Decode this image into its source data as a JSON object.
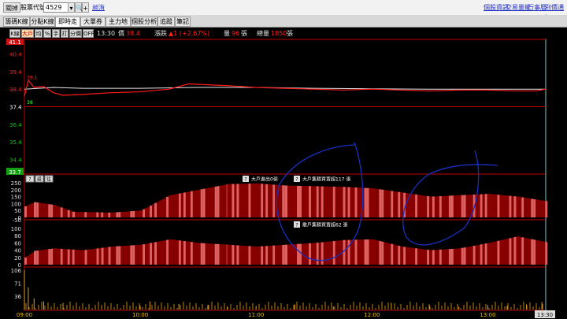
{
  "window": {
    "close_button": "關掉",
    "stock_code_label": "股票代號:",
    "stock_code_value": "4529",
    "search_icon_glyph": "🔍",
    "add_button": "+",
    "stock_name": "昶洧",
    "links": [
      "個股資訊",
      "交易量能",
      "行事曆",
      "到價通知"
    ]
  },
  "tabs": [
    "籌碼K線",
    "分點K線",
    "即時走勢",
    "大單券商",
    "主力地圖",
    "個股分析",
    "追蹤",
    "筆記"
  ],
  "active_tab": "即時走勢",
  "toolbar": {
    "buttons": [
      "K線",
      "大戶",
      "均",
      "%",
      "手",
      "打",
      "分價",
      "OFF"
    ],
    "selected": "大戶",
    "time": "13:30",
    "price_label": "價",
    "price_value": "38.4",
    "change_label": "漲跌",
    "change_value": "▲1 (+2.67%)",
    "volume_label": "量",
    "volume_value": "96",
    "volume_unit": "張",
    "total_label": "總量",
    "total_value": "1850",
    "total_unit": "張"
  },
  "colors": {
    "price_line": "#ff1a1a",
    "avg_line": "#e8e8e8",
    "big_buy_fill": "#e06060",
    "dark_fill": "#8a0000",
    "annotation_ink": "#1830c0",
    "up_color": "#ff2020",
    "down_color": "#00d000",
    "panel_border": "#c00000"
  },
  "chart_data": {
    "type": "line",
    "time_axis": [
      "09:00",
      "10:00",
      "11:00",
      "12:00",
      "13:00"
    ],
    "current_time_label": "13:30",
    "price_panel": {
      "y_ticks_up": [
        "41.1",
        "40.4",
        "39.4",
        "38.4"
      ],
      "y_ticks_down": [
        "37.4",
        "36.4",
        "35.4",
        "34.4",
        "33.7"
      ],
      "open_high_label": "39.1",
      "open_low_label": "38",
      "limit_up": 41.1,
      "limit_down": 33.7,
      "reference": 37.4,
      "price_series": [
        [
          "09:00",
          38.0
        ],
        [
          "09:02",
          38.9
        ],
        [
          "09:05",
          38.5
        ],
        [
          "09:10",
          38.55
        ],
        [
          "09:15",
          38.2
        ],
        [
          "09:20",
          38.05
        ],
        [
          "09:30",
          38.1
        ],
        [
          "09:45",
          38.2
        ],
        [
          "10:00",
          38.25
        ],
        [
          "10:15",
          38.4
        ],
        [
          "10:25",
          38.7
        ],
        [
          "10:35",
          38.65
        ],
        [
          "10:45",
          38.6
        ],
        [
          "11:00",
          38.5
        ],
        [
          "11:15",
          38.45
        ],
        [
          "11:30",
          38.4
        ],
        [
          "11:45",
          38.35
        ],
        [
          "12:00",
          38.4
        ],
        [
          "12:15",
          38.35
        ],
        [
          "12:30",
          38.3
        ],
        [
          "12:45",
          38.35
        ],
        [
          "13:00",
          38.35
        ],
        [
          "13:15",
          38.3
        ],
        [
          "13:25",
          38.3
        ],
        [
          "13:30",
          38.4
        ]
      ],
      "avg_series": [
        [
          "09:00",
          38.4
        ],
        [
          "09:15",
          38.5
        ],
        [
          "09:30",
          38.45
        ],
        [
          "10:00",
          38.45
        ],
        [
          "10:30",
          38.5
        ],
        [
          "11:00",
          38.5
        ],
        [
          "11:30",
          38.45
        ],
        [
          "12:00",
          38.42
        ],
        [
          "12:30",
          38.4
        ],
        [
          "13:00",
          38.4
        ],
        [
          "13:30",
          38.4
        ]
      ]
    },
    "big_player_panel": {
      "header_buttons": [
        "?",
        "設",
        "往"
      ],
      "label_outflow": "大戶進出0張",
      "label_hold": "大戶集積買賣超117 張",
      "y_ticks": [
        "250",
        "200",
        "150",
        "100",
        "50",
        "0"
      ],
      "series": [
        [
          "09:00",
          80
        ],
        [
          "09:05",
          110
        ],
        [
          "09:15",
          90
        ],
        [
          "09:25",
          40
        ],
        [
          "09:45",
          35
        ],
        [
          "10:00",
          50
        ],
        [
          "10:15",
          160
        ],
        [
          "10:30",
          200
        ],
        [
          "10:45",
          240
        ],
        [
          "11:00",
          245
        ],
        [
          "11:15",
          230
        ],
        [
          "11:30",
          225
        ],
        [
          "11:45",
          220
        ],
        [
          "12:00",
          210
        ],
        [
          "12:15",
          180
        ],
        [
          "12:30",
          150
        ],
        [
          "12:45",
          160
        ],
        [
          "13:00",
          170
        ],
        [
          "13:15",
          150
        ],
        [
          "13:30",
          117
        ]
      ]
    },
    "retail_panel": {
      "label": "散戶集積買賣超62 張",
      "y_ticks": [
        "-50",
        "0",
        "20",
        "40",
        "60",
        "80",
        "100"
      ],
      "series": [
        [
          "09:00",
          20
        ],
        [
          "09:05",
          38
        ],
        [
          "09:15",
          45
        ],
        [
          "09:30",
          40
        ],
        [
          "09:45",
          50
        ],
        [
          "10:00",
          55
        ],
        [
          "10:15",
          70
        ],
        [
          "10:30",
          60
        ],
        [
          "10:45",
          55
        ],
        [
          "11:00",
          50
        ],
        [
          "11:15",
          55
        ],
        [
          "11:30",
          60
        ],
        [
          "11:45",
          68
        ],
        [
          "12:00",
          70
        ],
        [
          "12:15",
          50
        ],
        [
          "12:30",
          40
        ],
        [
          "12:45",
          45
        ],
        [
          "13:00",
          60
        ],
        [
          "13:15",
          78
        ],
        [
          "13:30",
          62
        ]
      ]
    },
    "volume_panel": {
      "y_ticks": [
        "106",
        "71",
        "36"
      ],
      "max": 106,
      "spikes": [
        [
          "09:00",
          106
        ],
        [
          "09:02",
          60
        ],
        [
          "09:05",
          30
        ],
        [
          "09:10",
          22
        ],
        [
          "09:20",
          18
        ],
        [
          "09:40",
          12
        ],
        [
          "10:00",
          10
        ],
        [
          "10:05",
          22
        ],
        [
          "10:20",
          15
        ],
        [
          "10:35",
          12
        ],
        [
          "10:45",
          8
        ],
        [
          "11:00",
          10
        ],
        [
          "11:20",
          14
        ],
        [
          "11:40",
          8
        ],
        [
          "12:10",
          18
        ],
        [
          "12:30",
          10
        ],
        [
          "12:45",
          8
        ],
        [
          "13:00",
          12
        ],
        [
          "13:10",
          10
        ],
        [
          "13:20",
          14
        ],
        [
          "13:28",
          20
        ]
      ]
    }
  }
}
